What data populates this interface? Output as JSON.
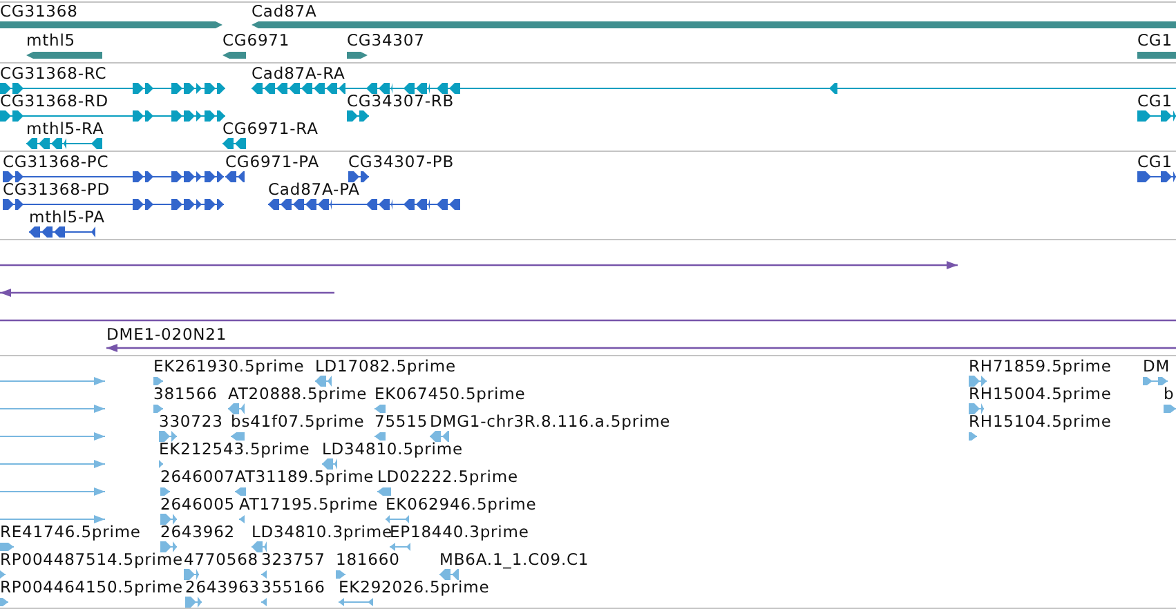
{
  "tracks": [
    {
      "kind": "gene",
      "features": [
        {
          "label": "CG31368",
          "reverse": false
        },
        {
          "label": "Cad87A",
          "reverse": true
        },
        {
          "label": "mthl5",
          "reverse": true
        },
        {
          "label": "CG6971",
          "reverse": true
        },
        {
          "label": "CG34307",
          "reverse": false
        },
        {
          "label": "CG1",
          "reverse": false
        }
      ]
    },
    {
      "kind": "transcript",
      "features": [
        {
          "label": "CG31368-RC",
          "reverse": false
        },
        {
          "label": "Cad87A-RA",
          "reverse": true
        },
        {
          "label": "CG31368-RD",
          "reverse": false
        },
        {
          "label": "CG34307-RB",
          "reverse": false
        },
        {
          "label": "CG1",
          "reverse": false
        },
        {
          "label": "mthl5-RA",
          "reverse": true
        },
        {
          "label": "CG6971-RA",
          "reverse": true
        }
      ]
    },
    {
      "kind": "protein",
      "features": [
        {
          "label": "CG31368-PC",
          "reverse": false
        },
        {
          "label": "CG6971-PA",
          "reverse": true
        },
        {
          "label": "CG34307-PB",
          "reverse": false
        },
        {
          "label": "CG1",
          "reverse": false
        },
        {
          "label": "CG31368-PD",
          "reverse": false
        },
        {
          "label": "Cad87A-PA",
          "reverse": true
        },
        {
          "label": "mthl5-PA",
          "reverse": true
        }
      ]
    },
    {
      "kind": "clone",
      "features": [
        {
          "reverse": false
        },
        {
          "reverse": true
        },
        {
          "reverse": false
        },
        {
          "label": "DME1-020N21",
          "reverse": true
        }
      ]
    },
    {
      "kind": "est",
      "features": [
        {
          "reverse": false
        },
        {
          "reverse": false
        },
        {
          "reverse": false
        },
        {
          "reverse": false
        },
        {
          "reverse": false
        },
        {
          "reverse": false
        },
        {
          "label": "EK261930.5prime",
          "reverse": false
        },
        {
          "label": "LD17082.5prime",
          "reverse": true
        },
        {
          "label": "RH71859.5prime",
          "reverse": false
        },
        {
          "label": "DM",
          "reverse": false
        },
        {
          "label": "381566",
          "reverse": false
        },
        {
          "label": "AT20888.5prime",
          "reverse": true
        },
        {
          "label": "EK067450.5prime",
          "reverse": true
        },
        {
          "label": "RH15004.5prime",
          "reverse": false
        },
        {
          "label": "b",
          "reverse": false
        },
        {
          "label": "330723",
          "reverse": false
        },
        {
          "label": "bs41f07.5prime",
          "reverse": true
        },
        {
          "label": "75515",
          "reverse": true
        },
        {
          "label": "DMG1-chr3R.8.116.a.5prime",
          "reverse": true
        },
        {
          "label": "RH15104.5prime",
          "reverse": false
        },
        {
          "label": "EK212543.5prime",
          "reverse": false
        },
        {
          "label": "LD34810.5prime",
          "reverse": true
        },
        {
          "label": "2646007",
          "reverse": false
        },
        {
          "label": "AT31189.5prime",
          "reverse": true
        },
        {
          "label": "LD02222.5prime",
          "reverse": true
        },
        {
          "label": "2646005",
          "reverse": false
        },
        {
          "label": "AT17195.5prime",
          "reverse": true
        },
        {
          "label": "EK062946.5prime",
          "reverse": true
        },
        {
          "label": "RE41746.5prime",
          "reverse": false
        },
        {
          "label": "2643962",
          "reverse": false
        },
        {
          "label": "LD34810.3prime",
          "reverse": true
        },
        {
          "label": "EP18440.3prime",
          "reverse": true
        },
        {
          "label": "RP004487514.5prime",
          "reverse": false
        },
        {
          "label": "4770568",
          "reverse": false
        },
        {
          "label": "323757",
          "reverse": true
        },
        {
          "label": "181660",
          "reverse": false
        },
        {
          "label": "MB6A.1_1.C09.C1",
          "reverse": true
        },
        {
          "label": "RP004464150.5prime",
          "reverse": false
        },
        {
          "label": "2643963",
          "reverse": false
        },
        {
          "label": "355166",
          "reverse": true
        },
        {
          "label": "EK292026.5prime",
          "reverse": true
        }
      ]
    }
  ]
}
